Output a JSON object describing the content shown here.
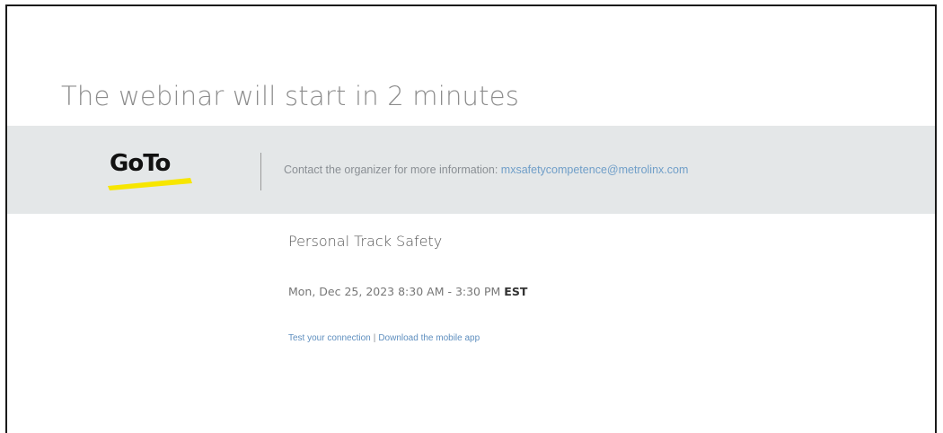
{
  "page": {
    "countdown_title": "The webinar will start in 2 minutes"
  },
  "banner": {
    "logo_text": "GoTo",
    "logo_accent_color": "#f7e600",
    "contact_prefix": "Contact the organizer for more information: ",
    "contact_email": "mxsafetycompetence@metrolinx.com"
  },
  "event": {
    "title": "Personal Track Safety",
    "datetime": "Mon, Dec 25, 2023 8:30 AM - 3:30 PM",
    "timezone": "EST"
  },
  "links": {
    "test_connection": "Test your connection",
    "separator": "|",
    "download_app": "Download the mobile app"
  },
  "colors": {
    "banner_bg": "#e4e7e8",
    "link": "#6f9ec8",
    "title_gray": "#8c8c8c"
  }
}
